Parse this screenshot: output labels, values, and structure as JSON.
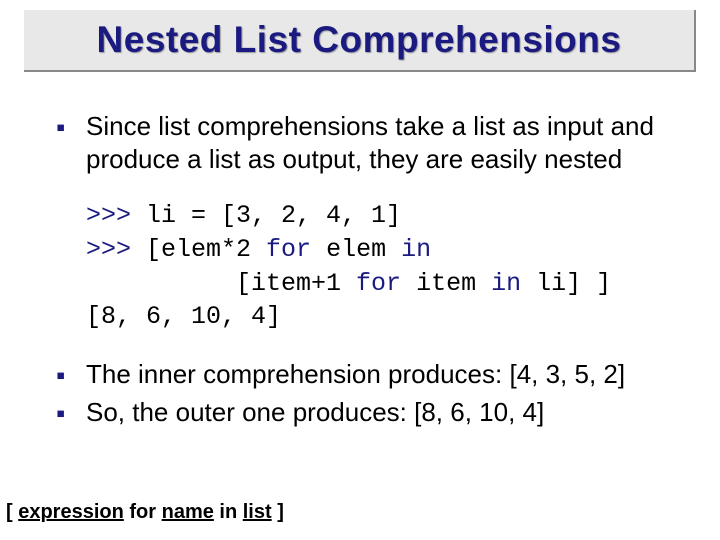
{
  "title": "Nested List Comprehensions",
  "bullets": {
    "b1": "Since list comprehensions take a list as input and produce a list as output, they are easily nested",
    "b2": "The inner comprehension produces: [4, 3, 5, 2]",
    "b3": "So, the outer one produces: [8, 6, 10, 4]"
  },
  "code": {
    "p1": ">>> ",
    "c1": "li = [3, 2, 4, 1]",
    "p2": ">>> ",
    "c2a": "[elem*2 ",
    "c2b": "for",
    "c2c": " elem ",
    "c2d": "in",
    "c3a": "          [item+1 ",
    "c3b": "for",
    "c3c": " item ",
    "c3d": "in",
    "c3e": " li] ]",
    "out": "[8, 6, 10, 4]"
  },
  "footer": {
    "lb": "[ ",
    "expr": "expression",
    "for_": " for ",
    "name": "name",
    "in_": " in ",
    "list": "list",
    "rb": " ]"
  }
}
